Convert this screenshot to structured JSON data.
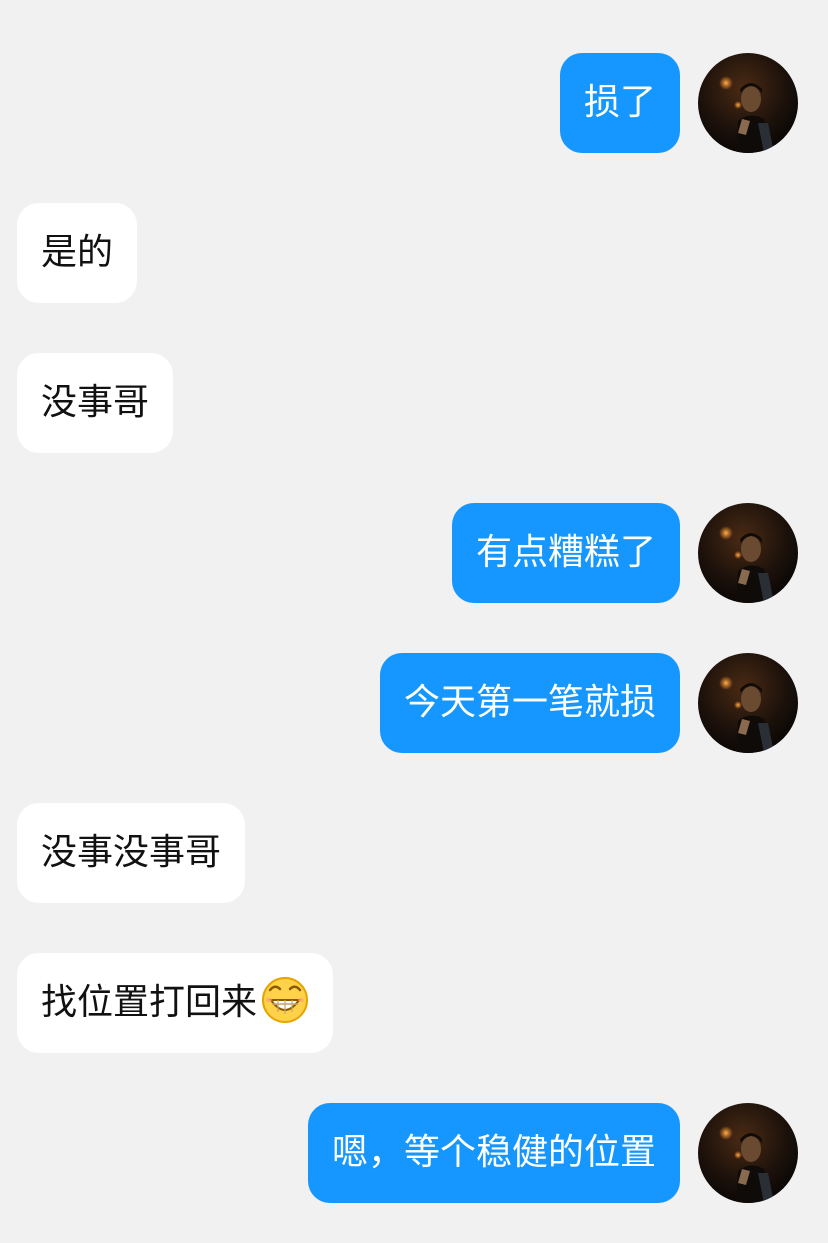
{
  "chat": {
    "messages": [
      {
        "side": "out",
        "text": "损了"
      },
      {
        "side": "in",
        "text": "是的"
      },
      {
        "side": "in",
        "text": "没事哥"
      },
      {
        "side": "out",
        "text": "有点糟糕了"
      },
      {
        "side": "out",
        "text": "今天第一笔就损"
      },
      {
        "side": "in",
        "text": "没事没事哥"
      },
      {
        "side": "in",
        "text": "找位置打回来",
        "emoji": "grinning-face-emoji"
      },
      {
        "side": "out",
        "text": "嗯，等个稳健的位置"
      }
    ]
  },
  "colors": {
    "background": "#f1f1f1",
    "outgoing_bubble": "#1597ff",
    "incoming_bubble": "#ffffff"
  }
}
